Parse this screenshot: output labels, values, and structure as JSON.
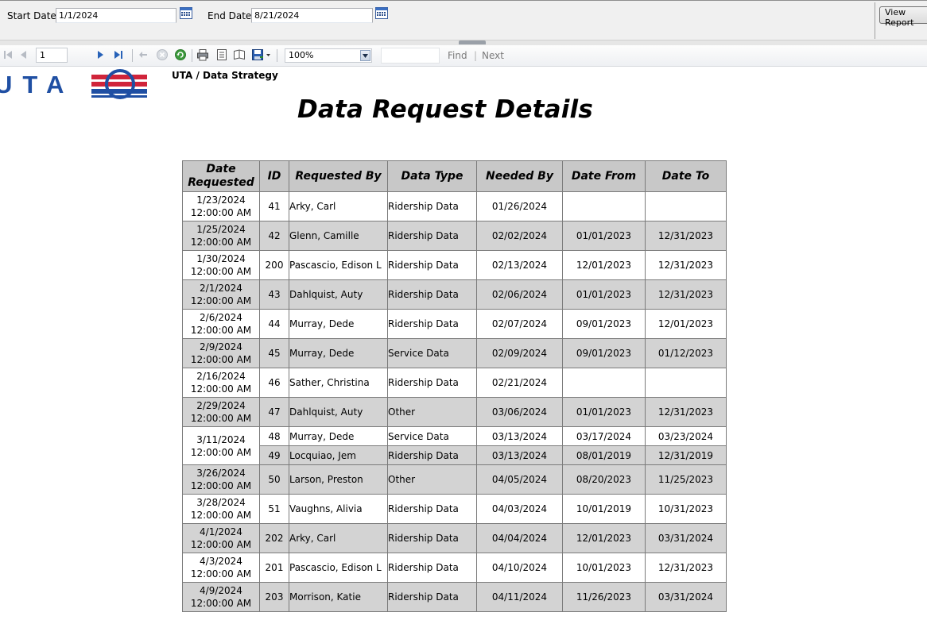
{
  "params": {
    "start_label": "Start Date",
    "start_value": "1/1/2024",
    "end_label": "End Date",
    "end_value": "8/21/2024",
    "view_report_label": "View Report"
  },
  "toolbar": {
    "page_number": "1",
    "zoom": "100%",
    "find_label": "Find",
    "find_separator": "|",
    "next_label": "Next"
  },
  "header": {
    "org_name": "UTA / Data Strategy",
    "title": "Data Request Details",
    "logo_text": "UTA"
  },
  "colors": {
    "logo_blue": "#1f4fa3",
    "logo_red": "#d0243a",
    "header_fill": "#c8c8c8",
    "row_shade": "#d3d3d3"
  },
  "table": {
    "headers": [
      "Date\nRequested",
      "ID",
      "Requested By",
      "Data Type",
      "Needed By",
      "Date From",
      "Date To"
    ],
    "groups": [
      {
        "date": "1/23/2024\n12:00:00 AM",
        "rows": [
          {
            "id": "41",
            "requested_by": "Arky, Carl",
            "data_type": "Ridership Data",
            "needed_by": "01/26/2024",
            "date_from": "",
            "date_to": ""
          }
        ]
      },
      {
        "date": "1/25/2024\n12:00:00 AM",
        "rows": [
          {
            "id": "42",
            "requested_by": "Glenn, Camille",
            "data_type": "Ridership Data",
            "needed_by": "02/02/2024",
            "date_from": "01/01/2023",
            "date_to": "12/31/2023"
          }
        ]
      },
      {
        "date": "1/30/2024\n12:00:00 AM",
        "rows": [
          {
            "id": "200",
            "requested_by": "Pascascio, Edison L",
            "data_type": "Ridership Data",
            "needed_by": "02/13/2024",
            "date_from": "12/01/2023",
            "date_to": "12/31/2023"
          }
        ]
      },
      {
        "date": "2/1/2024\n12:00:00 AM",
        "rows": [
          {
            "id": "43",
            "requested_by": "Dahlquist, Auty",
            "data_type": "Ridership Data",
            "needed_by": "02/06/2024",
            "date_from": "01/01/2023",
            "date_to": "12/31/2023"
          }
        ]
      },
      {
        "date": "2/6/2024\n12:00:00 AM",
        "rows": [
          {
            "id": "44",
            "requested_by": "Murray, Dede",
            "data_type": "Ridership Data",
            "needed_by": "02/07/2024",
            "date_from": "09/01/2023",
            "date_to": "12/01/2023"
          }
        ]
      },
      {
        "date": "2/9/2024\n12:00:00 AM",
        "rows": [
          {
            "id": "45",
            "requested_by": "Murray, Dede",
            "data_type": "Service Data",
            "needed_by": "02/09/2024",
            "date_from": "09/01/2023",
            "date_to": "01/12/2023"
          }
        ]
      },
      {
        "date": "2/16/2024\n12:00:00 AM",
        "rows": [
          {
            "id": "46",
            "requested_by": "Sather, Christina",
            "data_type": "Ridership Data",
            "needed_by": "02/21/2024",
            "date_from": "",
            "date_to": ""
          }
        ]
      },
      {
        "date": "2/29/2024\n12:00:00 AM",
        "rows": [
          {
            "id": "47",
            "requested_by": "Dahlquist, Auty",
            "data_type": "Other",
            "needed_by": "03/06/2024",
            "date_from": "01/01/2023",
            "date_to": "12/31/2023"
          }
        ]
      },
      {
        "date": "3/11/2024\n12:00:00 AM",
        "rows": [
          {
            "id": "48",
            "requested_by": "Murray, Dede",
            "data_type": "Service Data",
            "needed_by": "03/13/2024",
            "date_from": "03/17/2024",
            "date_to": "03/23/2024"
          },
          {
            "id": "49",
            "requested_by": "Locquiao, Jem",
            "data_type": "Ridership Data",
            "needed_by": "03/13/2024",
            "date_from": "08/01/2019",
            "date_to": "12/31/2019"
          }
        ]
      },
      {
        "date": "3/26/2024\n12:00:00 AM",
        "rows": [
          {
            "id": "50",
            "requested_by": "Larson, Preston",
            "data_type": "Other",
            "needed_by": "04/05/2024",
            "date_from": "08/20/2023",
            "date_to": "11/25/2023"
          }
        ]
      },
      {
        "date": "3/28/2024\n12:00:00 AM",
        "rows": [
          {
            "id": "51",
            "requested_by": "Vaughns, Alivia",
            "data_type": "Ridership Data",
            "needed_by": "04/03/2024",
            "date_from": "10/01/2019",
            "date_to": "10/31/2023"
          }
        ]
      },
      {
        "date": "4/1/2024\n12:00:00 AM",
        "rows": [
          {
            "id": "202",
            "requested_by": "Arky, Carl",
            "data_type": "Ridership Data",
            "needed_by": "04/04/2024",
            "date_from": "12/01/2023",
            "date_to": "03/31/2024"
          }
        ]
      },
      {
        "date": "4/3/2024\n12:00:00 AM",
        "rows": [
          {
            "id": "201",
            "requested_by": "Pascascio, Edison L",
            "data_type": "Ridership Data",
            "needed_by": "04/10/2024",
            "date_from": "10/01/2023",
            "date_to": "12/31/2023"
          }
        ]
      },
      {
        "date": "4/9/2024\n12:00:00 AM",
        "rows": [
          {
            "id": "203",
            "requested_by": "Morrison, Katie",
            "data_type": "Ridership Data",
            "needed_by": "04/11/2024",
            "date_from": "11/26/2023",
            "date_to": "03/31/2024"
          }
        ]
      }
    ]
  }
}
